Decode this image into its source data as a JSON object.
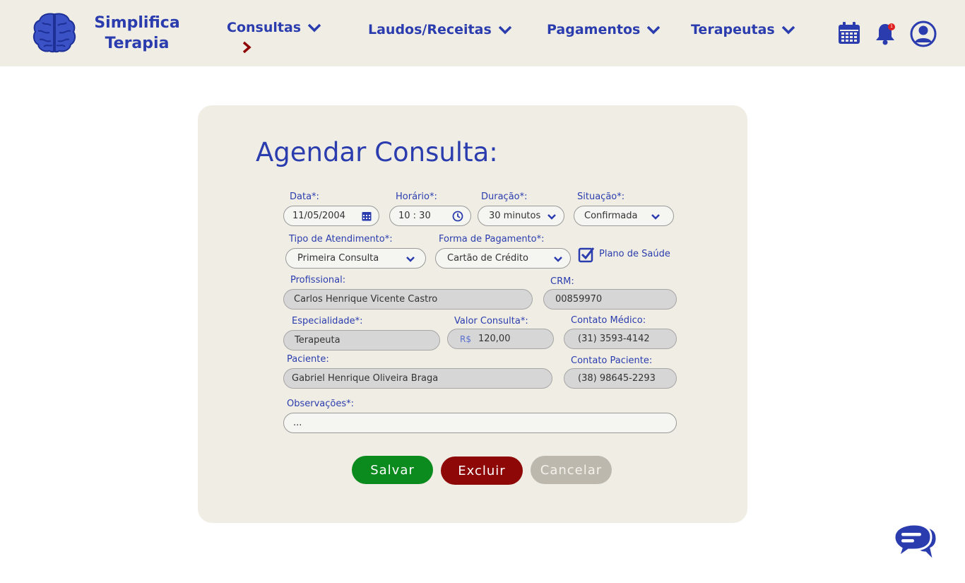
{
  "header": {
    "brand_line1": "Simplifica",
    "brand_line2": "Terapia",
    "nav": [
      "Consultas",
      "Laudos/Receitas",
      "Pagamentos",
      "Terapeutas"
    ],
    "notification_count": "1"
  },
  "form": {
    "title": "Agendar Consulta:",
    "data": {
      "label": "Data*:",
      "value": "11/05/2004"
    },
    "horario": {
      "label": "Horário*:",
      "value": "10 : 30"
    },
    "duracao": {
      "label": "Duração*:",
      "value": "30 minutos"
    },
    "situacao": {
      "label": "Situação*:",
      "value": "Confirmada"
    },
    "tipo": {
      "label": "Tipo de Atendimento*:",
      "value": "Primeira Consulta"
    },
    "pagamento": {
      "label": "Forma de Pagamento*:",
      "value": "Cartão de Crédito"
    },
    "plano": {
      "label": "Plano de Saúde",
      "checked": true
    },
    "profissional": {
      "label": "Profissional:",
      "value": "Carlos Henrique Vicente Castro"
    },
    "crm": {
      "label": "CRM:",
      "value": "00859970"
    },
    "especialidade": {
      "label": "Especialidade*:",
      "value": "Terapeuta"
    },
    "valor": {
      "label": "Valor Consulta*:",
      "prefix": "R$",
      "value": "120,00"
    },
    "contato_medico": {
      "label": "Contato Médico:",
      "value": "(31) 3593-4142"
    },
    "paciente": {
      "label": "Paciente:",
      "value": "Gabriel Henrique Oliveira Braga"
    },
    "contato_paciente": {
      "label": "Contato Paciente:",
      "value": "(38) 98645-2293"
    },
    "observacoes": {
      "label": "Observações*:",
      "value": "..."
    }
  },
  "buttons": {
    "save": "Salvar",
    "delete": "Excluir",
    "cancel": "Cancelar"
  },
  "colors": {
    "primary": "#2a3cae",
    "header_bg": "#f0eee4",
    "save": "#0b8a1e",
    "delete": "#8e0808",
    "cancel": "#bdb8ae",
    "accent_arrow": "#8e0808"
  }
}
